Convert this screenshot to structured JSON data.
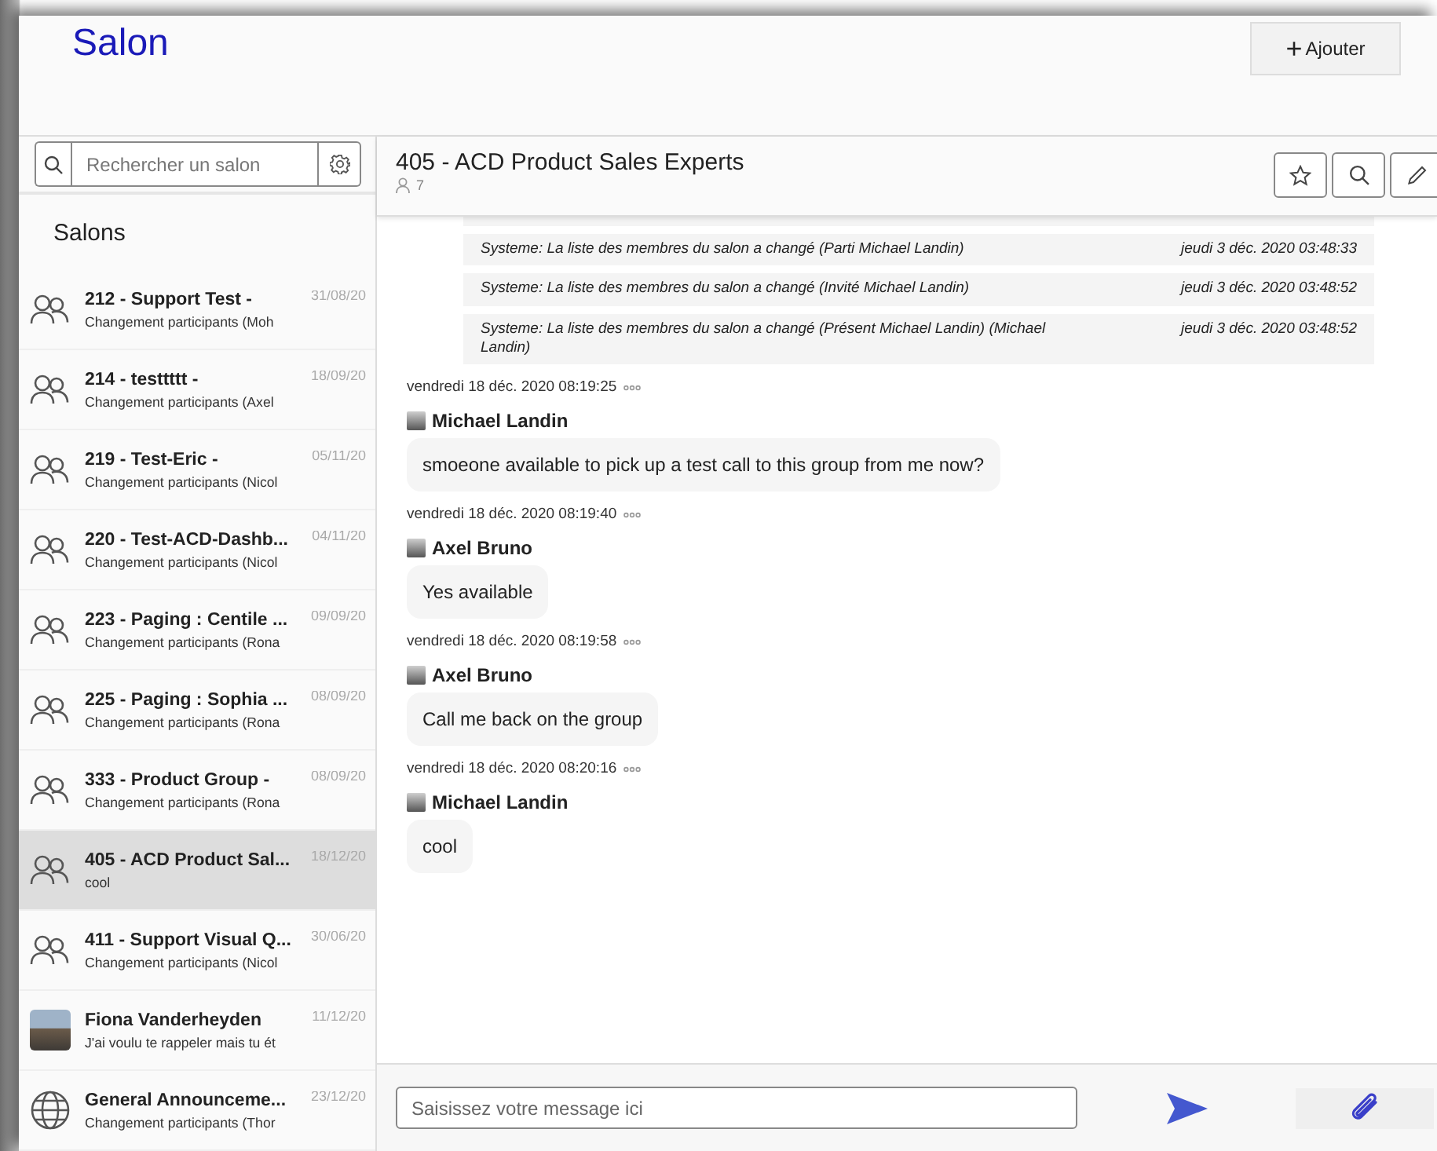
{
  "header": {
    "title": "Salon",
    "add_button": {
      "icon": "+",
      "label": "Ajouter"
    }
  },
  "sidebar": {
    "search": {
      "placeholder": "Rechercher un salon"
    },
    "heading": "Salons",
    "rooms": [
      {
        "kind": "group",
        "name": "212 - Support Test -",
        "date": "31/08/20",
        "preview": "Changement participants (Moh",
        "selected": false
      },
      {
        "kind": "group",
        "name": "214 - testtttt -",
        "date": "18/09/20",
        "preview": "Changement participants (Axel",
        "selected": false
      },
      {
        "kind": "group",
        "name": "219 - Test-Eric -",
        "date": "05/11/20",
        "preview": "Changement participants (Nicol",
        "selected": false
      },
      {
        "kind": "group",
        "name": "220 - Test-ACD-Dashb...",
        "date": "04/11/20",
        "preview": "Changement participants (Nicol",
        "selected": false
      },
      {
        "kind": "group",
        "name": "223 - Paging : Centile ...",
        "date": "09/09/20",
        "preview": "Changement participants (Rona",
        "selected": false
      },
      {
        "kind": "group",
        "name": "225 - Paging : Sophia ...",
        "date": "08/09/20",
        "preview": "Changement participants (Rona",
        "selected": false
      },
      {
        "kind": "group",
        "name": "333 - Product Group -",
        "date": "08/09/20",
        "preview": "Changement participants (Rona",
        "selected": false
      },
      {
        "kind": "group",
        "name": "405 - ACD Product Sal...",
        "date": "18/12/20",
        "preview": "cool",
        "selected": true
      },
      {
        "kind": "group",
        "name": "411 - Support Visual Q...",
        "date": "30/06/20",
        "preview": "Changement participants (Nicol",
        "selected": false
      },
      {
        "kind": "person",
        "name": "Fiona Vanderheyden",
        "date": "11/12/20",
        "preview": "J'ai voulu te rappeler mais tu ét",
        "selected": false
      },
      {
        "kind": "broadcast",
        "name": "General Announceme...",
        "date": "23/12/20",
        "preview": "Changement participants (Thor",
        "selected": false
      }
    ]
  },
  "chat": {
    "title": "405 - ACD Product Sales Experts",
    "member_count": "7",
    "system_messages": [
      {
        "text": "Systeme: La liste des membres du salon a changé (Parti Michael Landin)",
        "time": "jeudi 3 déc. 2020 03:48:33"
      },
      {
        "text": "Systeme: La liste des membres du salon a changé (Invité Michael Landin)",
        "time": "jeudi 3 déc. 2020 03:48:52"
      },
      {
        "text": "Systeme: La liste des membres du salon a changé (Présent Michael Landin) (Michael Landin)",
        "time": "jeudi 3 déc. 2020 03:48:52"
      }
    ],
    "messages": [
      {
        "time": "vendredi 18 déc. 2020 08:19:25",
        "author": "Michael Landin",
        "text": "smoeone available to pick up a test call to this group from me now?"
      },
      {
        "time": "vendredi 18 déc. 2020 08:19:40",
        "author": "Axel Bruno",
        "text": "Yes available"
      },
      {
        "time": "vendredi 18 déc. 2020 08:19:58",
        "author": "Axel Bruno",
        "text": "Call me back on the group"
      },
      {
        "time": "vendredi 18 déc. 2020 08:20:16",
        "author": "Michael Landin",
        "text": "cool"
      }
    ],
    "composer": {
      "placeholder": "Saisissez votre message ici"
    }
  }
}
